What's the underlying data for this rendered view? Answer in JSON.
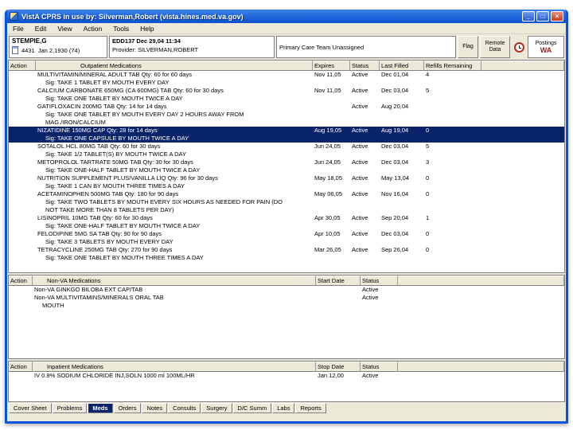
{
  "colors": {
    "selection": "#0a246a",
    "titlebar_start": "#3a81e8",
    "titlebar_end": "#0d50cf",
    "window_frame": "#0855dd",
    "chrome_bg": "#ece9d8",
    "postings_color": "#8d1f1f"
  },
  "window": {
    "title": "VistA CPRS in use by: Silverman,Robert  (vista.hines.med.va.gov)",
    "minimize": "_",
    "maximize": "□",
    "close": "×"
  },
  "menu": {
    "items": [
      "File",
      "Edit",
      "View",
      "Action",
      "Tools",
      "Help"
    ]
  },
  "patient": {
    "name": "STEMPIE,G",
    "id": "4431",
    "dob": "Jan 2,1930 (74)",
    "visit": "EDD137 Dec 29,04 11:34",
    "provider": "Provider: SILVERMAN,ROBERT",
    "care_team": "Primary Care Team Unassigned",
    "flag_label": "Flag",
    "remote_data_label": "Remote Data",
    "postings_label": "Postings",
    "postings_value": "WA"
  },
  "outpatient": {
    "columns": [
      "Action",
      "Outpatient Medications",
      "Expires",
      "Status",
      "Last Filled",
      "Refills Remaining"
    ],
    "rows": [
      {
        "name": "MULTIVITAMIN/MINERAL ADULT TAB Qty: 60 for 60 days",
        "sig": [
          "Sig: TAKE 1 TABLET BY MOUTH EVERY DAY"
        ],
        "expires": "Nov 11,05",
        "status": "Active",
        "filled": "Dec 01,04",
        "refills": "4",
        "selected": false
      },
      {
        "name": "CALCIUM CARBONATE 650MG (CA 600MG) TAB Qty: 60 for 30 days",
        "sig": [
          "Sig: TAKE ONE TABLET BY MOUTH TWICE A DAY"
        ],
        "expires": "Nov 11,05",
        "status": "Active",
        "filled": "Dec 03,04",
        "refills": "5",
        "selected": false
      },
      {
        "name": "GATIFLOXACIN 200MG TAB Qty: 14 for 14 days",
        "sig": [
          "Sig: TAKE ONE TABLET BY MOUTH EVERY DAY 2 HOURS AWAY FROM",
          "MAG./IRON/CALCIUM"
        ],
        "expires": "",
        "status": "Active",
        "filled": "Aug 20,04",
        "refills": "",
        "selected": false
      },
      {
        "name": "NIZATIDINE 150MG CAP Qty: 28 for 14 days",
        "sig": [
          "Sig: TAKE ONE CAPSULE BY MOUTH TWICE A DAY"
        ],
        "expires": "Aug 19,05",
        "status": "Active",
        "filled": "Aug 19,04",
        "refills": "0",
        "selected": true
      },
      {
        "name": "SOTALOL HCL 80MG TAB Qty: 60 for 30 days",
        "sig": [
          "Sig: TAKE 1/2 TABLET(S) BY MOUTH TWICE A DAY"
        ],
        "expires": "Jun 24,05",
        "status": "Active",
        "filled": "Dec 03,04",
        "refills": "5",
        "selected": false
      },
      {
        "name": "METOPROLOL TARTRATE 50MG TAB Qty: 30 for 30 days",
        "sig": [
          "Sig: TAKE ONE-HALF TABLET BY MOUTH TWICE A DAY"
        ],
        "expires": "Jun 24,05",
        "status": "Active",
        "filled": "Dec 03,04",
        "refills": "3",
        "selected": false
      },
      {
        "name": "NUTRITION SUPPLEMENT PLUS/VANILLA LIQ Qty: 96 for 30 days",
        "sig": [
          "Sig: TAKE 1 CAN BY MOUTH THREE TIMES A DAY"
        ],
        "expires": "May 18,05",
        "status": "Active",
        "filled": "May 13,04",
        "refills": "0",
        "selected": false
      },
      {
        "name": "ACETAMINOPHEN 500MG TAB Qty: 180 for 90 days",
        "sig": [
          "Sig: TAKE TWO TABLETS BY MOUTH EVERY SIX HOURS AS NEEDED FOR PAIN (DO",
          "NOT TAKE MORE THAN 8 TABLETS PER DAY)"
        ],
        "expires": "May 06,05",
        "status": "Active",
        "filled": "Nov 16,04",
        "refills": "0",
        "selected": false
      },
      {
        "name": "LISINOPRIL 10MG TAB Qty: 60 for 30 days",
        "sig": [
          "Sig: TAKE ONE-HALF TABLET BY MOUTH TWICE A DAY"
        ],
        "expires": "Apr 30,05",
        "status": "Active",
        "filled": "Sep 20,04",
        "refills": "1",
        "selected": false
      },
      {
        "name": "FELODIPINE 5MG SA TAB Qty: 90 for 90 days",
        "sig": [
          "Sig: TAKE 3 TABLETS BY MOUTH EVERY DAY"
        ],
        "expires": "Apr 10,05",
        "status": "Active",
        "filled": "Dec 03,04",
        "refills": "0",
        "selected": false
      },
      {
        "name": "TETRACYCLINE 250MG TAB Qty: 270 for 90 days",
        "sig": [
          "Sig: TAKE ONE TABLET BY MOUTH THREE TIMES A DAY"
        ],
        "expires": "Mar 26,05",
        "status": "Active",
        "filled": "Sep 26,04",
        "refills": "0",
        "selected": false
      }
    ]
  },
  "nonva": {
    "columns": [
      "Action",
      "Non-VA Medications",
      "Start Date",
      "Status"
    ],
    "rows": [
      {
        "name": "Non-VA  GINKGO BILOBA EXT CAP/TAB",
        "lines": [],
        "date": "",
        "status": "Active"
      },
      {
        "name": "Non-VA  MULTIVITAMINS/MINERALS ORAL TAB",
        "lines": [
          "MOUTH"
        ],
        "date": "",
        "status": "Active"
      }
    ]
  },
  "inpatient": {
    "columns": [
      "Action",
      "Inpatient Medications",
      "Stop Date",
      "Status"
    ],
    "rows": [
      {
        "name": "IV 0.9% SODIUM CHLORIDE INJ,SOLN 1000 ml 100ML/HR",
        "lines": [],
        "date": "Jan 12,00",
        "status": "Active"
      }
    ]
  },
  "tabs": {
    "items": [
      "Cover Sheet",
      "Problems",
      "Meds",
      "Orders",
      "Notes",
      "Consults",
      "Surgery",
      "D/C Summ",
      "Labs",
      "Reports"
    ],
    "active": "Meds"
  }
}
